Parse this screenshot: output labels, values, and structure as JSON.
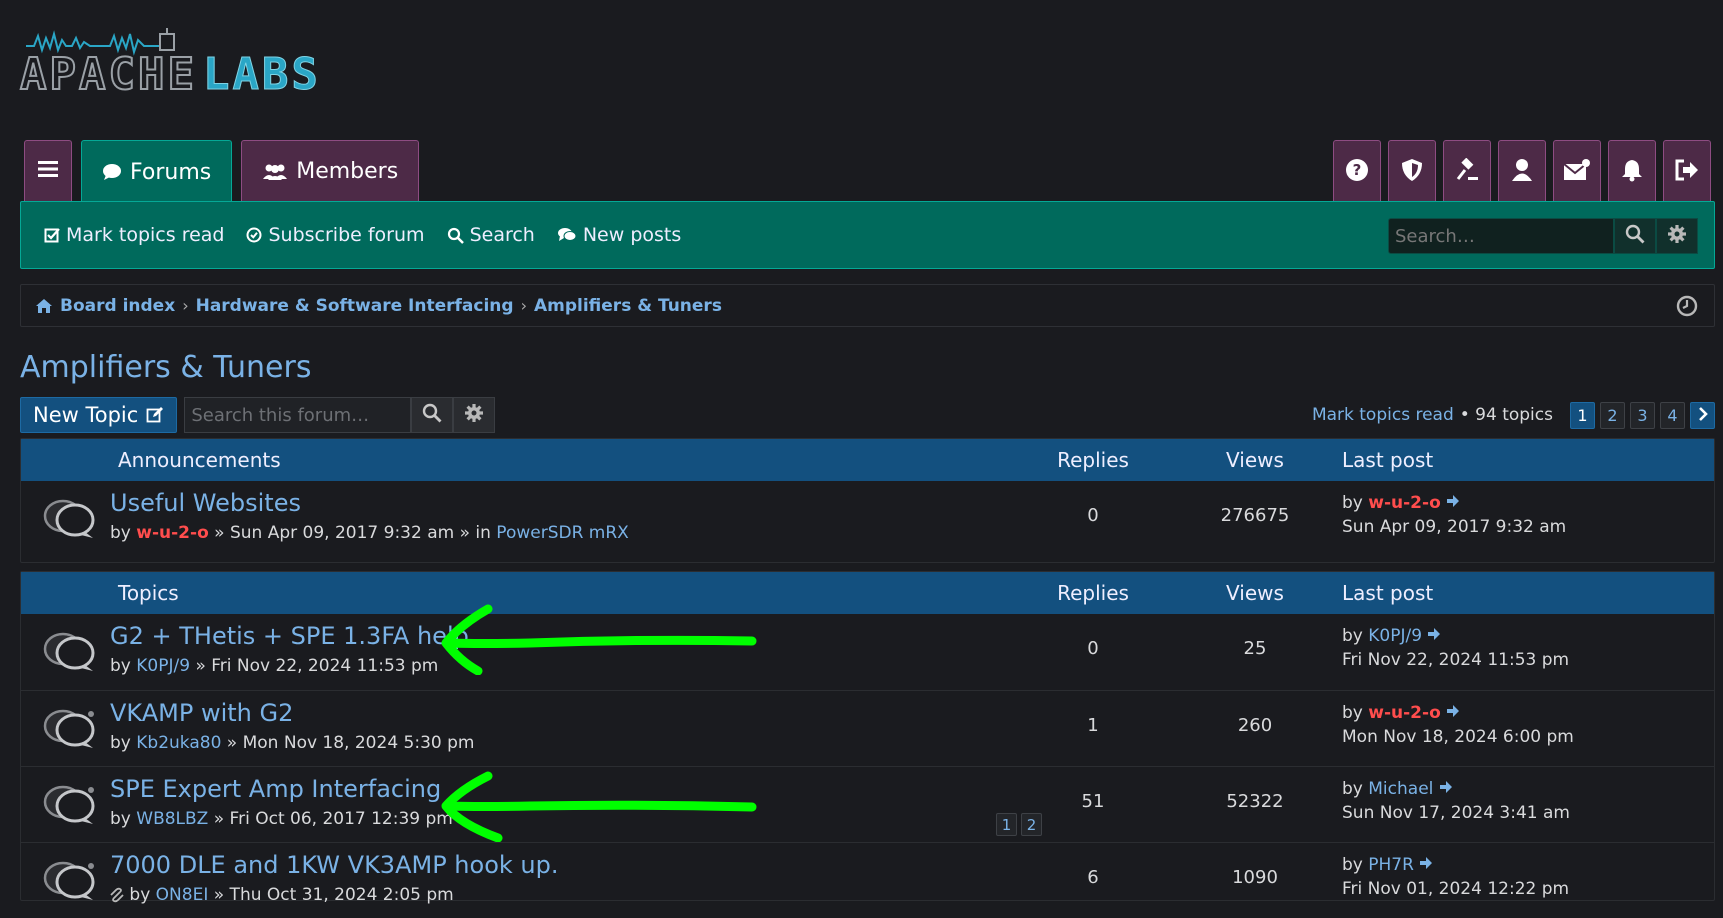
{
  "logo": {
    "part1": "APACHE",
    "part2": "LABS"
  },
  "tabs": [
    {
      "label": "Forums",
      "icon": "chat-bubble-icon"
    },
    {
      "label": "Members",
      "icon": "users-icon"
    }
  ],
  "toolbar_icons": [
    "help-icon",
    "shield-icon",
    "gavel-icon",
    "user-icon",
    "envelope-icon",
    "bell-icon",
    "logout-icon"
  ],
  "navbar": {
    "links": [
      {
        "label": "Mark topics read",
        "icon": "check-square-icon"
      },
      {
        "label": "Subscribe forum",
        "icon": "check-circle-icon"
      },
      {
        "label": "Search",
        "icon": "search-icon"
      },
      {
        "label": "New posts",
        "icon": "comments-icon"
      }
    ],
    "search_placeholder": "Search…"
  },
  "breadcrumb": {
    "items": [
      "Board index",
      "Hardware & Software Interfacing",
      "Amplifiers & Tuners"
    ]
  },
  "page": {
    "title": "Amplifiers & Tuners",
    "new_topic_label": "New Topic",
    "forum_search_placeholder": "Search this forum…",
    "mark_topics_read": "Mark topics read",
    "topic_count": "• 94 topics",
    "pages": [
      "1",
      "2",
      "3",
      "4"
    ],
    "current_page": "1"
  },
  "announcements": {
    "header": {
      "main": "Announcements",
      "replies": "Replies",
      "views": "Views",
      "last_post": "Last post"
    },
    "rows": [
      {
        "title": "Useful Websites",
        "by": "by",
        "author": "w-u-2-o",
        "author_color": "red",
        "meta": "» Sun Apr 09, 2017 9:32 am » in",
        "forum": "PowerSDR mRX",
        "replies": "0",
        "views": "276675",
        "last_by": "w-u-2-o",
        "last_color": "red",
        "last_date": "Sun Apr 09, 2017 9:32 am"
      }
    ]
  },
  "topics": {
    "header": {
      "main": "Topics",
      "replies": "Replies",
      "views": "Views",
      "last_post": "Last post"
    },
    "rows": [
      {
        "title": "G2 + THetis + SPE 1.3FA help",
        "by": "by",
        "author": "K0PJ/9",
        "meta": "» Fri Nov 22, 2024 11:53 pm",
        "replies": "0",
        "views": "25",
        "last_by": "K0PJ/9",
        "last_color": "blue",
        "last_date": "Fri Nov 22, 2024 11:53 pm"
      },
      {
        "title": "VKAMP with G2",
        "by": "by",
        "author": "Kb2uka80",
        "meta": "» Mon Nov 18, 2024 5:30 pm",
        "replies": "1",
        "views": "260",
        "last_by": "w-u-2-o",
        "last_color": "red",
        "last_date": "Mon Nov 18, 2024 6:00 pm"
      },
      {
        "title": "SPE Expert Amp Interfacing",
        "by": "by",
        "author": "WB8LBZ",
        "meta": "» Fri Oct 06, 2017 12:39 pm",
        "replies": "51",
        "views": "52322",
        "last_by": "Michael",
        "last_color": "blue",
        "last_date": "Sun Nov 17, 2024 3:41 am",
        "mini_pages": [
          "1",
          "2"
        ]
      },
      {
        "title": "7000 DLE and 1KW VK3AMP hook up.",
        "by": "by",
        "author": "ON8EI",
        "meta": "» Thu Oct 31, 2024 2:05 pm",
        "replies": "6",
        "views": "1090",
        "last_by": "PH7R",
        "last_color": "blue",
        "last_date": "Fri Nov 01, 2024 12:22 pm"
      }
    ]
  },
  "annotation_color": "#00ff00"
}
